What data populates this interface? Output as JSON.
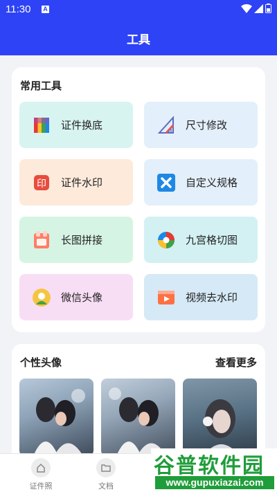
{
  "status": {
    "time": "11:30",
    "badge": "A"
  },
  "header": {
    "title": "工具"
  },
  "tools": {
    "section_title": "常用工具",
    "items": [
      {
        "label": "证件换底",
        "icon": "color-swatch-icon",
        "bg": "#d8f4f1"
      },
      {
        "label": "尺寸修改",
        "icon": "ruler-icon",
        "bg": "#e3effa"
      },
      {
        "label": "证件水印",
        "icon": "stamp-icon",
        "bg": "#fdeadb"
      },
      {
        "label": "自定义规格",
        "icon": "custom-spec-icon",
        "bg": "#e3effa"
      },
      {
        "label": "长图拼接",
        "icon": "long-image-icon",
        "bg": "#d6f4e4"
      },
      {
        "label": "九宫格切图",
        "icon": "aperture-icon",
        "bg": "#d3f1f3"
      },
      {
        "label": "微信头像",
        "icon": "avatar-icon",
        "bg": "#f8def4"
      },
      {
        "label": "视频去水印",
        "icon": "video-icon",
        "bg": "#d6e9f6"
      }
    ]
  },
  "avatars": {
    "section_title": "个性头像",
    "more_label": "查看更多"
  },
  "nav": [
    {
      "label": "证件照",
      "icon": "home-icon"
    },
    {
      "label": "文档",
      "icon": "folder-icon"
    }
  ],
  "watermark": {
    "text": "谷普软件园",
    "url": "www.gupuxiazai.com"
  }
}
